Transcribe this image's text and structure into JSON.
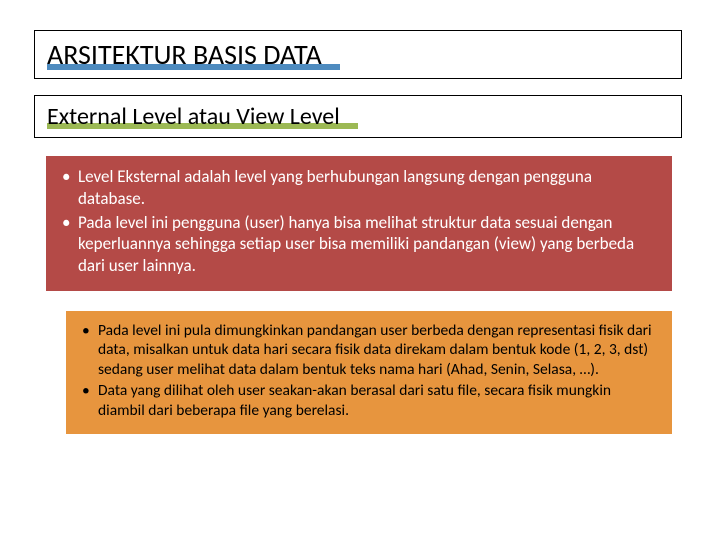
{
  "title": "ARSITEKTUR BASIS DATA",
  "subtitle": "External Level atau View Level",
  "redBullets": [
    "Level Eksternal adalah level yang berhubungan langsung dengan pengguna database.",
    "Pada level ini pengguna (user) hanya bisa melihat struktur data sesuai dengan keperluannya sehingga setiap user bisa memiliki pandangan (view) yang berbeda dari user lainnya."
  ],
  "orangeBullets": [
    "Pada level ini pula dimungkinkan pandangan user berbeda dengan representasi fisik dari data, misalkan untuk data hari secara fisik data direkam dalam bentuk kode (1, 2, 3, dst) sedang user melihat data dalam bentuk teks nama hari (Ahad, Senin, Selasa, …).",
    "Data yang dilihat oleh user seakan-akan berasal dari satu file, secara fisik mungkin diambil dari beberapa file yang berelasi."
  ],
  "colors": {
    "titleAccent": "#4e8bbf",
    "subtitleAccent": "#9cb954",
    "redBox": "#b44a47",
    "orangeBox": "#e7953e"
  }
}
